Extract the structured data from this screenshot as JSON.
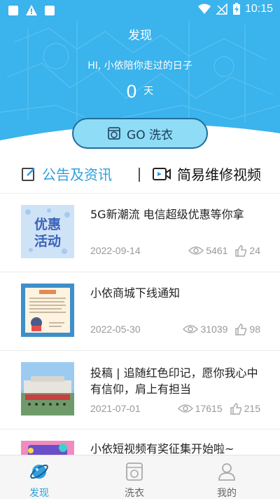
{
  "status_bar": {
    "time": "10:15"
  },
  "header": {
    "title": "发现",
    "greeting": "HI, 小依陪你走过的日子",
    "days_count": "0",
    "days_unit": "天",
    "go_button_label": "GO 洗衣"
  },
  "tabs": [
    {
      "label": "公告及资讯",
      "active": true
    },
    {
      "label": "简易维修视频",
      "active": false
    }
  ],
  "feed": [
    {
      "title": "5G新潮流 电信超级优惠等你拿",
      "date": "2022-09-14",
      "views": "5461",
      "likes": "24",
      "thumb_text": "优惠活动"
    },
    {
      "title": "小依商城下线通知",
      "date": "2022-05-30",
      "views": "31039",
      "likes": "98"
    },
    {
      "title": "投稿 | 追随红色印记，愿你我心中有信仰，肩上有担当",
      "date": "2021-07-01",
      "views": "17615",
      "likes": "215"
    },
    {
      "title": "小依短视频有奖征集开始啦~"
    }
  ],
  "bottom_nav": [
    {
      "label": "发现",
      "active": true
    },
    {
      "label": "洗衣",
      "active": false
    },
    {
      "label": "我的",
      "active": false
    }
  ],
  "colors": {
    "header_bg": "#3bb3ec",
    "accent": "#2d9fe0",
    "go_button_bg": "#8fdcf7",
    "go_button_border": "#1f6d9a"
  }
}
